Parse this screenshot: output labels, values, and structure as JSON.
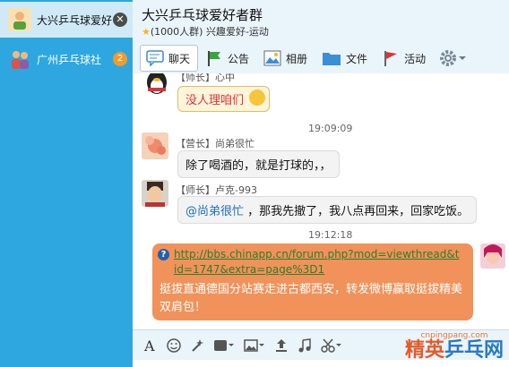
{
  "sidebar": {
    "items": [
      {
        "label": "大兴乒乓球爱好者群",
        "active": true
      },
      {
        "label": "广州乒乓球社",
        "badge": "2"
      }
    ]
  },
  "header": {
    "title": "大兴乒乓球爱好者群",
    "subtitle": "(1000人群) 兴趣爱好-运动"
  },
  "tabs": [
    {
      "label": "聊天",
      "icon": "chat-icon"
    },
    {
      "label": "公告",
      "icon": "flag-icon"
    },
    {
      "label": "相册",
      "icon": "photo-icon"
    },
    {
      "label": "文件",
      "icon": "folder-icon"
    },
    {
      "label": "活动",
      "icon": "activity-flag-icon"
    }
  ],
  "messages": [
    {
      "sender": "【师长】心中",
      "text": "没人理咱们"
    },
    {
      "time": "19:09:09"
    },
    {
      "sender": "【营长】尚弟很忙",
      "text": "除了喝酒的，就是打球的，，"
    },
    {
      "sender": "【师长】卢克-993",
      "mention": "@尚弟很忙",
      "text": "，那我先撤了，我八点再回来，回家吃饭。"
    },
    {
      "time": "19:12:18"
    },
    {
      "link": "http://bbs.chinapp.cn/forum.php?mod=viewthread&tid=1747&extra=page%3D1",
      "text": "挺拔直通德国分站赛走进古都西安，转发微博赢取挺拔精美双肩包！"
    }
  ],
  "watermark": {
    "site": "cnpingpang.com",
    "brand_a": "精英",
    "brand_b": "乒乓网"
  },
  "colors": {
    "sidebar": "#2ea7e0",
    "accent": "#f0925a",
    "link": "#1f6fb6"
  }
}
